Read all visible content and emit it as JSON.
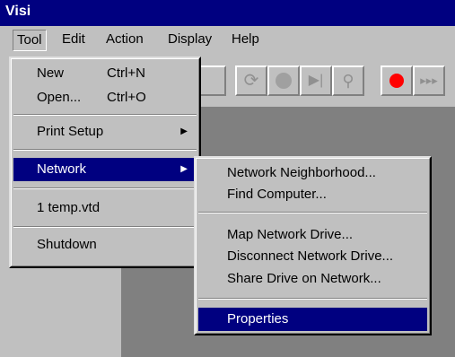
{
  "window": {
    "title": "Visi"
  },
  "menubar": {
    "items": [
      {
        "label": "Tool"
      },
      {
        "label": "Edit"
      },
      {
        "label": "Action"
      },
      {
        "label": "Display"
      },
      {
        "label": "Help"
      }
    ]
  },
  "tool_menu": {
    "new": {
      "label": "New",
      "accel": "Ctrl+N"
    },
    "open": {
      "label": "Open...",
      "accel": "Ctrl+O"
    },
    "print_setup": {
      "label": "Print Setup"
    },
    "network": {
      "label": "Network"
    },
    "recent": {
      "label": "1 temp.vtd"
    },
    "shutdown": {
      "label": "Shutdown"
    }
  },
  "network_menu": {
    "neighborhood": {
      "label": "Network Neighborhood..."
    },
    "find_computer": {
      "label": "Find Computer..."
    },
    "map_drive": {
      "label": "Map Network Drive..."
    },
    "disconnect_drive": {
      "label": "Disconnect Network Drive..."
    },
    "share_drive": {
      "label": "Share Drive on Network..."
    },
    "properties": {
      "label": "Properties"
    }
  },
  "toolbar": {
    "buttons": [
      {
        "icon": "blank-icon"
      },
      {
        "icon": "loop-icon"
      },
      {
        "icon": "stop-icon"
      },
      {
        "icon": "step-icon"
      },
      {
        "icon": "zoom-icon"
      },
      {
        "icon": "record-icon"
      },
      {
        "icon": "fast-forward-icon"
      }
    ]
  },
  "colors": {
    "titlebar": "#000080",
    "highlight": "#000080",
    "record": "#ff0000"
  }
}
